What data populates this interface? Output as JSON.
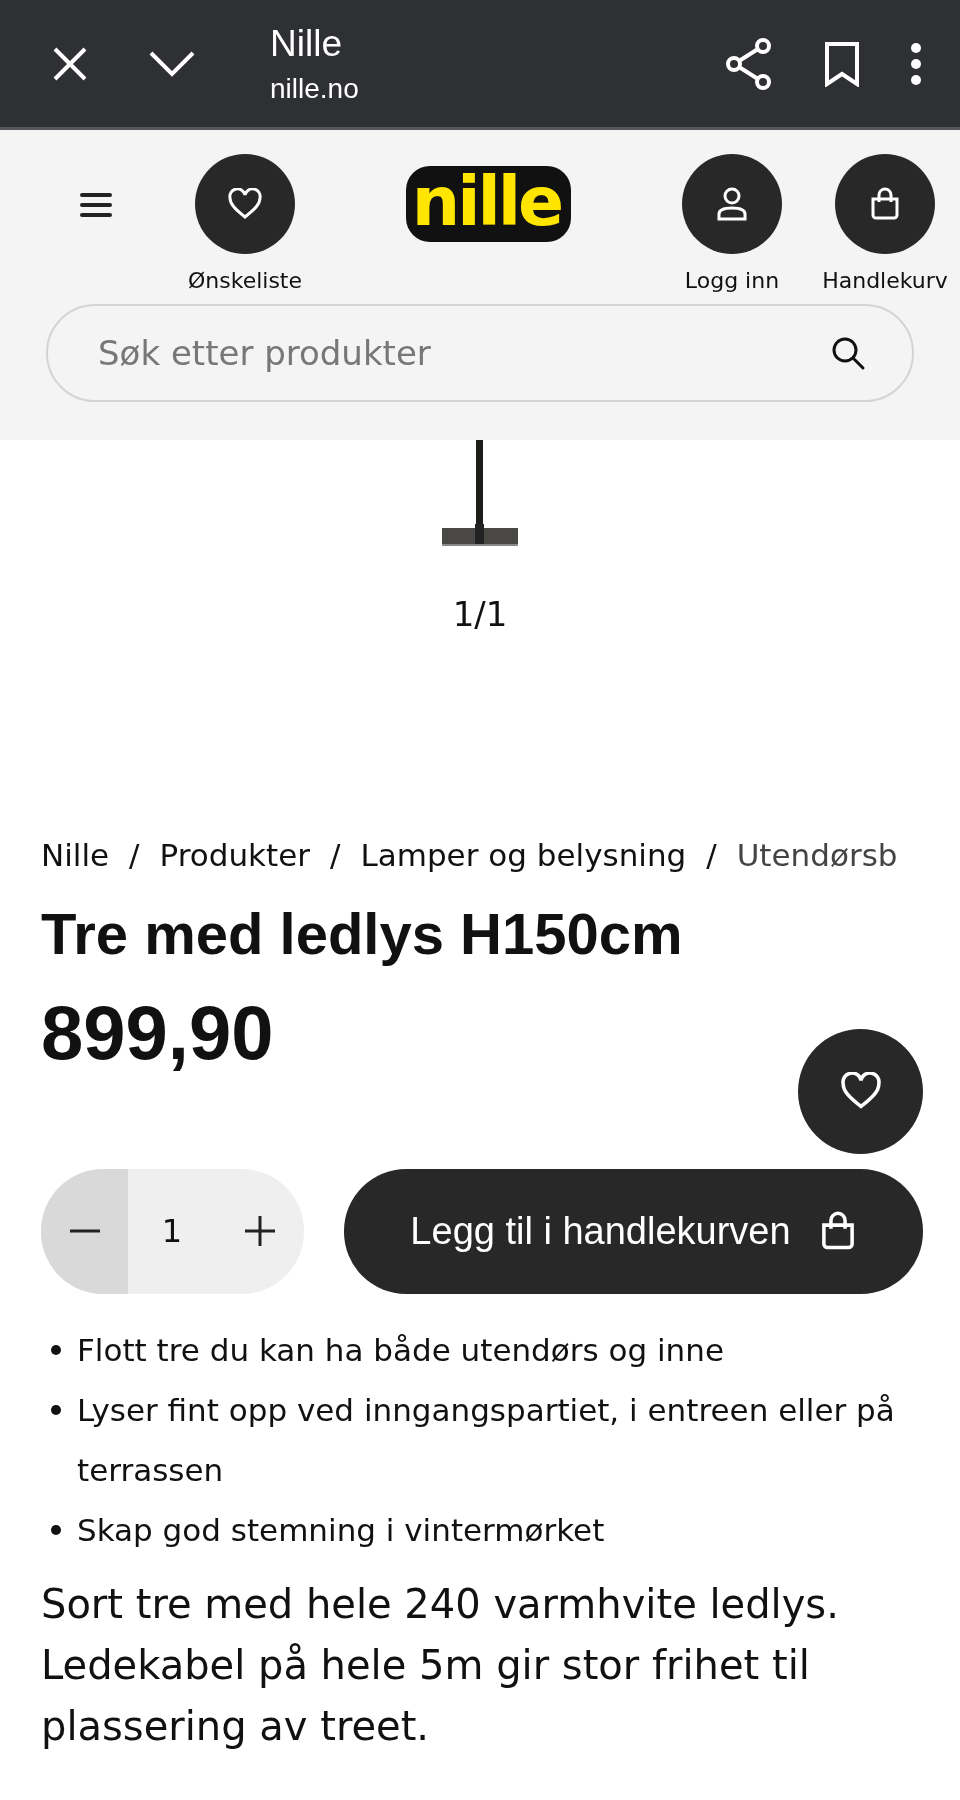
{
  "browser_bar": {
    "title": "Nille",
    "url": "nille.no"
  },
  "header": {
    "logo": "nille",
    "actions": [
      {
        "kind": "wishlist",
        "label": "Ønskeliste"
      },
      {
        "kind": "login",
        "label": "Logg inn"
      },
      {
        "kind": "cart",
        "label": "Handlekurv"
      }
    ],
    "search": {
      "placeholder": "Søk etter produkter"
    }
  },
  "gallery": {
    "kind": "picture",
    "counter": "1/1"
  },
  "breadcrumb": [
    "Nille",
    "Produkter",
    "Lamper og belysning",
    "Utendørsb"
  ],
  "breadcrumb_separator": "/",
  "product": {
    "title": "Tre med ledlys H150cm",
    "price": "899,90",
    "quantity": "1",
    "add_to_cart": "Legg til i handlekurven",
    "bullets": [
      "Flott tre du kan ha både utendørs og inne",
      "Lyser fint opp ved inngangspartiet, i entreen eller på terrassen",
      "Skap god stemning i vintermørket"
    ],
    "description": "Sort tre med hele 240 varmhvite ledlys. Ledekabel på hele 5m gir stor frihet til plassering av treet."
  }
}
